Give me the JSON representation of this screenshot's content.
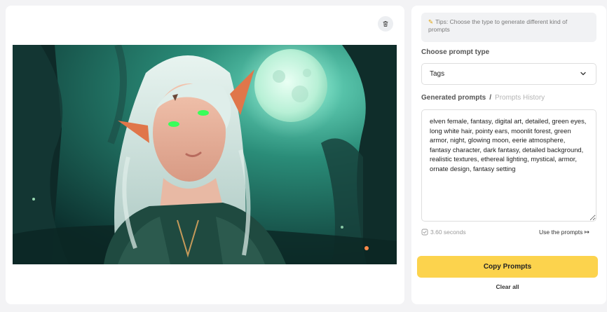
{
  "image_panel": {
    "delete_icon": "trash-icon",
    "image_description": "elf-portrait"
  },
  "settings": {
    "tips_icon": "lightbulb-icon",
    "tips_text": "Tips: Choose the type to generate different kind of prompts",
    "prompt_type_label": "Choose prompt type",
    "prompt_type_value": "Tags",
    "dropdown_icon": "chevron-down-icon"
  },
  "prompts": {
    "tab_generated": "Generated prompts",
    "tab_separator": "/",
    "tab_history": "Prompts History",
    "text": "elven female, fantasy, digital art, detailed, green eyes, long white hair, pointy ears, moonlit forest, green armor, night, glowing moon, eerie atmosphere, fantasy character, dark fantasy, detailed background, realistic textures, ethereal lighting, mystical, armor, ornate design, fantasy setting",
    "time_icon": "timer-icon",
    "time_text": "3.60 seconds",
    "use_link": "Use the prompts ↦"
  },
  "actions": {
    "copy_label": "Copy Prompts",
    "clear_label": "Clear all"
  },
  "colors": {
    "accent": "#fcd34d",
    "panel_bg": "#ffffff",
    "page_bg": "#f3f3f5"
  }
}
